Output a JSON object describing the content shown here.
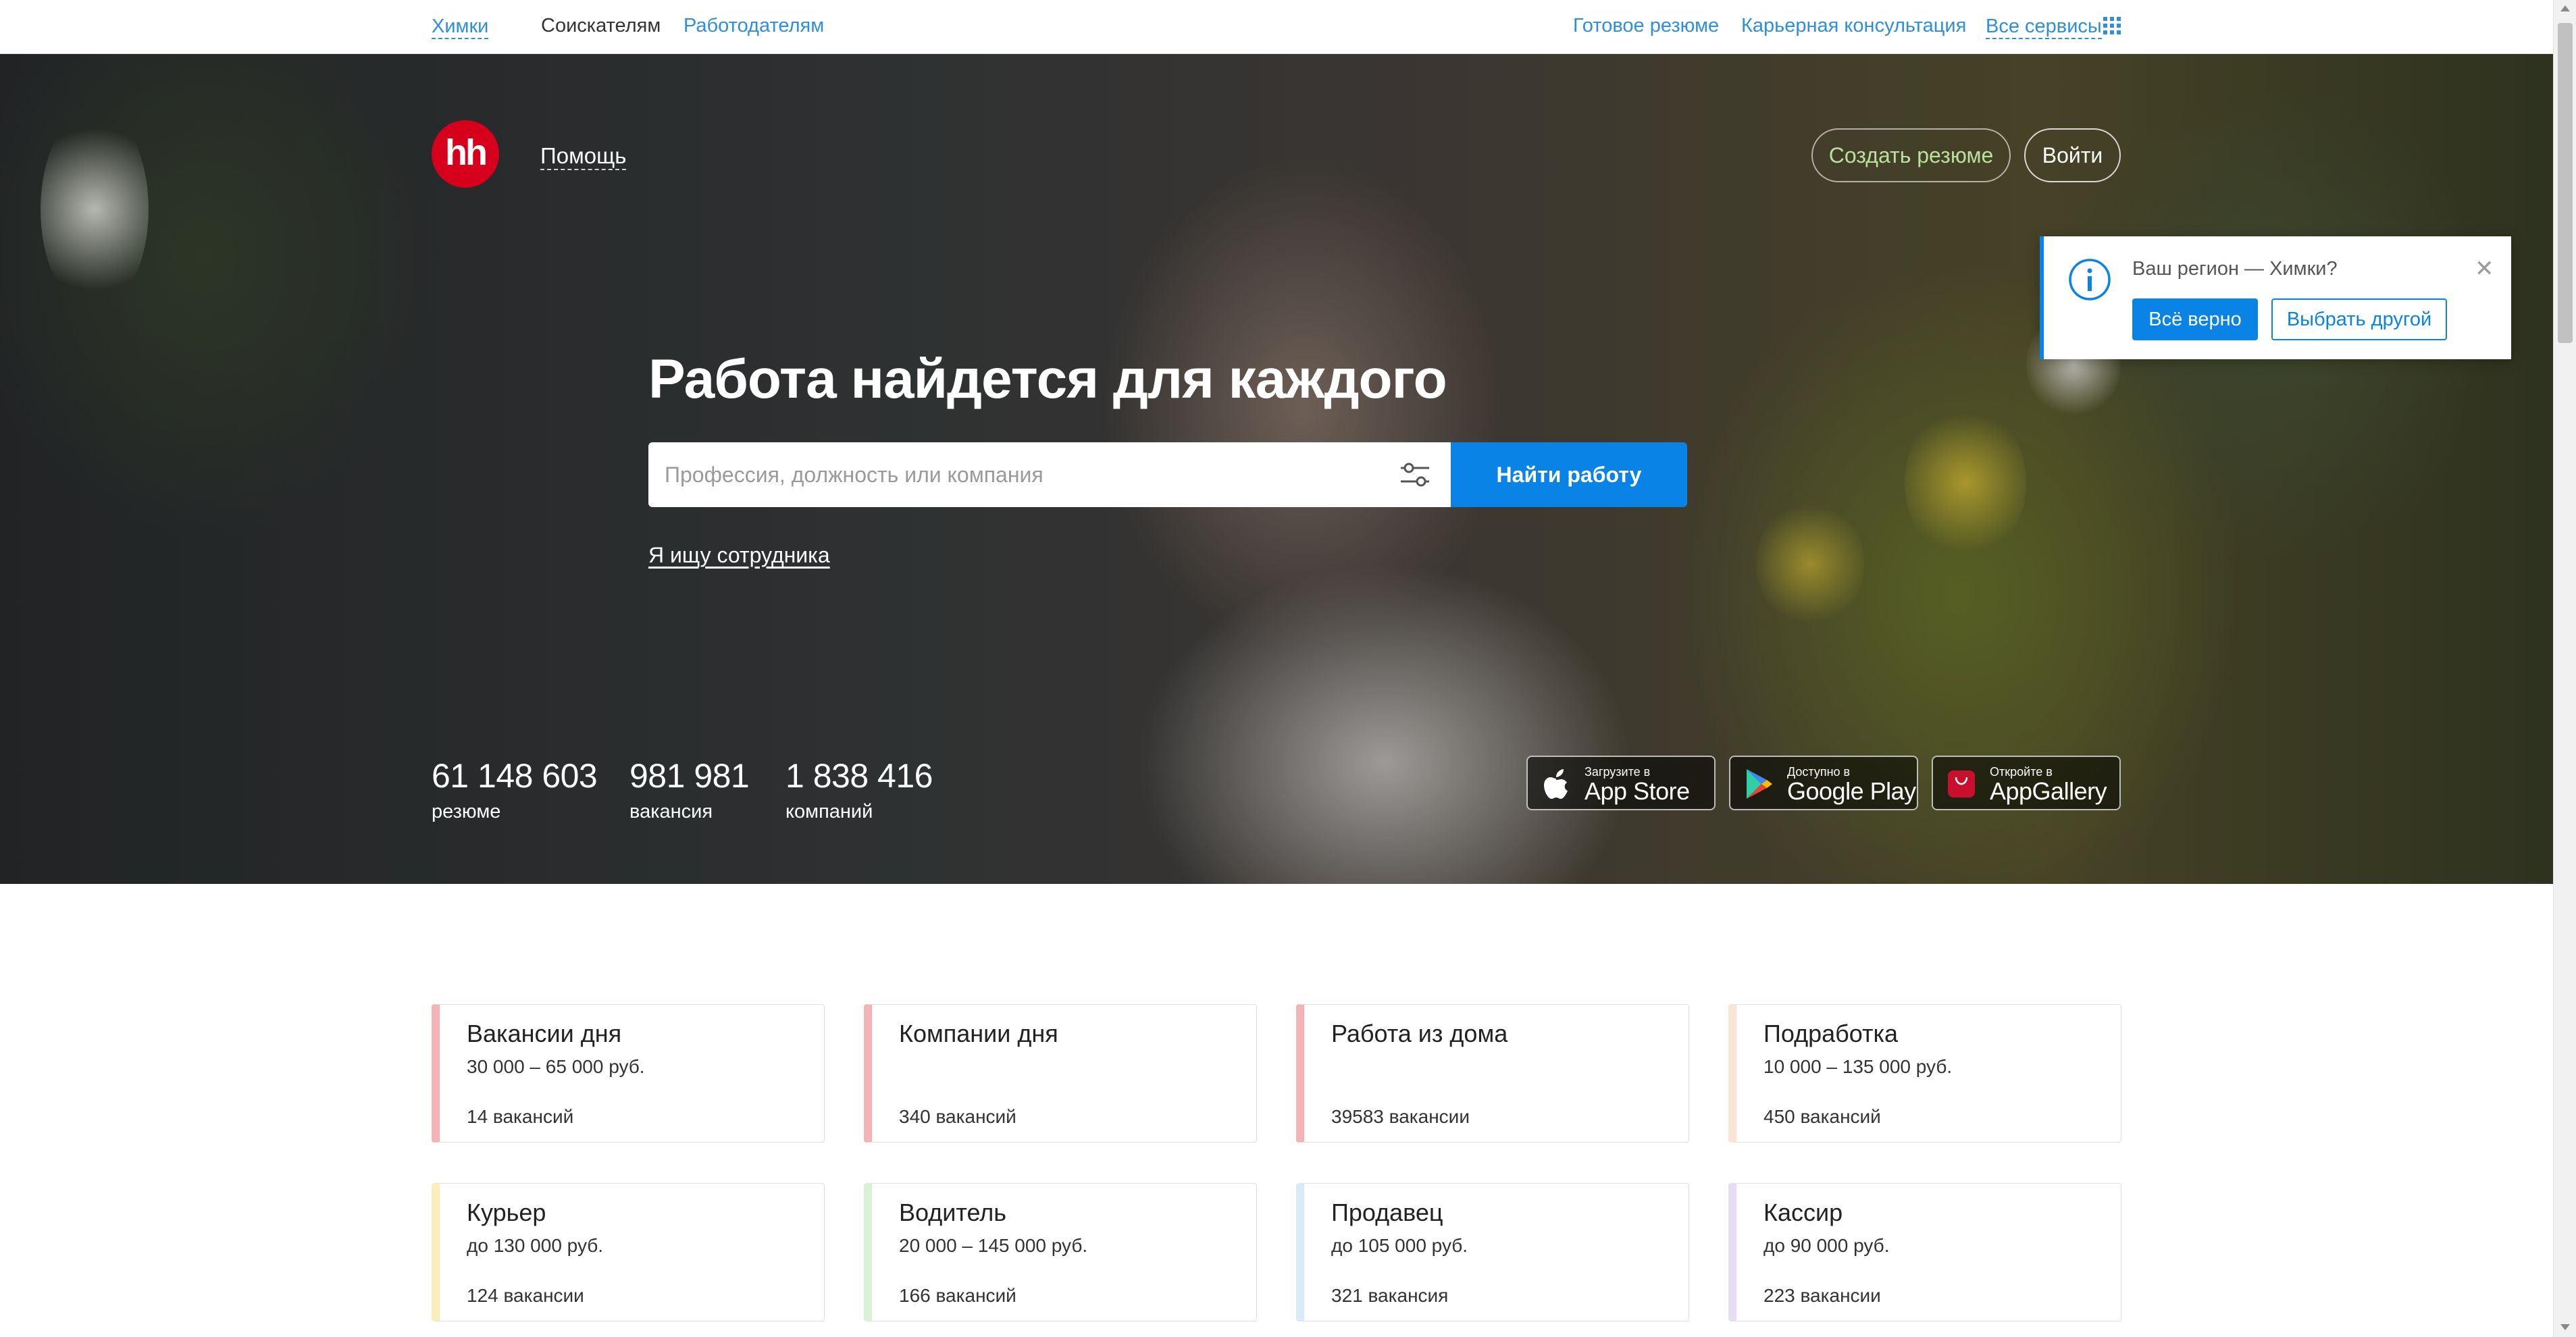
{
  "topbar": {
    "city": "Химки",
    "seekers": "Соискателям",
    "employers": "Работодателям",
    "ready_resume": "Готовое резюме",
    "career_consult": "Карьерная консультация",
    "all_services": "Все сервисы"
  },
  "header": {
    "logo_text": "hh",
    "help": "Помощь",
    "create_resume": "Создать резюме",
    "login": "Войти"
  },
  "hero": {
    "title": "Работа найдется для каждого",
    "search_placeholder": "Профессия, должность или компания",
    "search_value": "",
    "find_button": "Найти работу",
    "employer_link": "Я ищу сотрудника"
  },
  "stats": [
    {
      "value": "61 148 603",
      "label": "резюме"
    },
    {
      "value": "981 981",
      "label": "вакансия"
    },
    {
      "value": "1 838 416",
      "label": "компаний"
    }
  ],
  "stores": [
    {
      "small": "Загрузите в",
      "big": "App Store",
      "icon": "apple-icon"
    },
    {
      "small": "Доступно в",
      "big": "Google Play",
      "icon": "google-play-icon"
    },
    {
      "small": "Откройте в",
      "big": "AppGallery",
      "icon": "huawei-icon"
    }
  ],
  "region_popup": {
    "question": "Ваш регион — Химки?",
    "confirm": "Всё верно",
    "choose_other": "Выбрать другой",
    "accent_color": "#0a83e6"
  },
  "cards": [
    {
      "title": "Вакансии дня",
      "salary": "30 000 – 65 000 руб.",
      "count": "14 вакансий",
      "color": "#f3b3b7"
    },
    {
      "title": "Компании дня",
      "salary": "",
      "count": "340 вакансий",
      "color": "#f3b3b7"
    },
    {
      "title": "Работа из дома",
      "salary": "",
      "count": "39583 вакансии",
      "color": "#f3b3b7"
    },
    {
      "title": "Подработка",
      "salary": "10 000 – 135 000 руб.",
      "count": "450 вакансий",
      "color": "#fbe4d3"
    },
    {
      "title": "Курьер",
      "salary": "до 130 000 руб.",
      "count": "124 вакансии",
      "color": "#fbeebb"
    },
    {
      "title": "Водитель",
      "salary": "20 000 – 145 000 руб.",
      "count": "166 вакансий",
      "color": "#d9f2d6"
    },
    {
      "title": "Продавец",
      "salary": "до 105 000 руб.",
      "count": "321 вакансия",
      "color": "#d9eaf9"
    },
    {
      "title": "Кассир",
      "salary": "до 90 000 руб.",
      "count": "223 вакансии",
      "color": "#e6ddf5"
    }
  ],
  "colors": {
    "link": "#2f8fd8",
    "primary_button": "#0a83e6",
    "logo_red": "#d6001c"
  }
}
